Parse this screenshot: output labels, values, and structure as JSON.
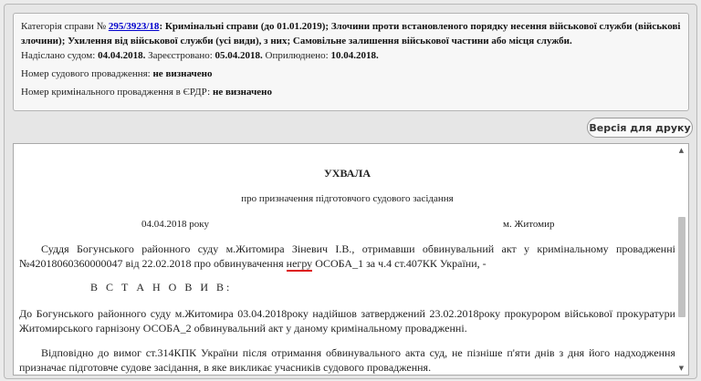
{
  "info": {
    "category_label": "Категорія справи №",
    "case_number": "295/3923/18",
    "category_text": ": Кримінальні справи (до 01.01.2019); Злочини проти встановленого порядку несення військової служби (військові злочини); Ухилення від військової служби (усі види), з них; Самовільне залишення військової частини або місця служби.",
    "sent_label": "Надіслано судом:",
    "sent_date": "04.04.2018.",
    "registered_label": "Зареєстровано:",
    "registered_date": "05.04.2018.",
    "published_label": "Оприлюднено:",
    "published_date": "10.04.2018.",
    "court_proc_label": "Номер судового провадження:",
    "court_proc_value": "не визначено",
    "criminal_proc_label": "Номер кримінального провадження в ЄРДР:",
    "criminal_proc_value": "не визначено"
  },
  "print_button": "Версія для друку",
  "document": {
    "title": "УХВАЛА",
    "subtitle": "про призначення підготовчого судового засідання",
    "date": "04.04.2018 року",
    "city": "м. Житомир",
    "p1_before": "Суддя Богунського районного суду м.Житомира Зіневич І.В., отримавши обвинувальний акт у кримінальному провадженні №42018060360000047 від 22.02.2018 про обвинувачення ",
    "p1_word": "негру",
    "p1_after": " ОСОБА_1 за ч.4 ст.407КК України, -",
    "vstanovyv": "В С Т А Н О В И В:",
    "p2": "До Богунського районного суду м.Житомира 03.04.2018року надійшов затверджений 23.02.2018року прокурором військової прокуратури Житомирського гарнізону ОСОБА_2 обвинувальний акт у даному кримінальному провадженні.",
    "p3": "Відповідно до вимог ст.314КПК України після отримання обвинувального акта суд, не пізніше п'яти днів з дня його надходження призначає підготовче судове засідання, в яке викликає учасників судового провадження."
  }
}
